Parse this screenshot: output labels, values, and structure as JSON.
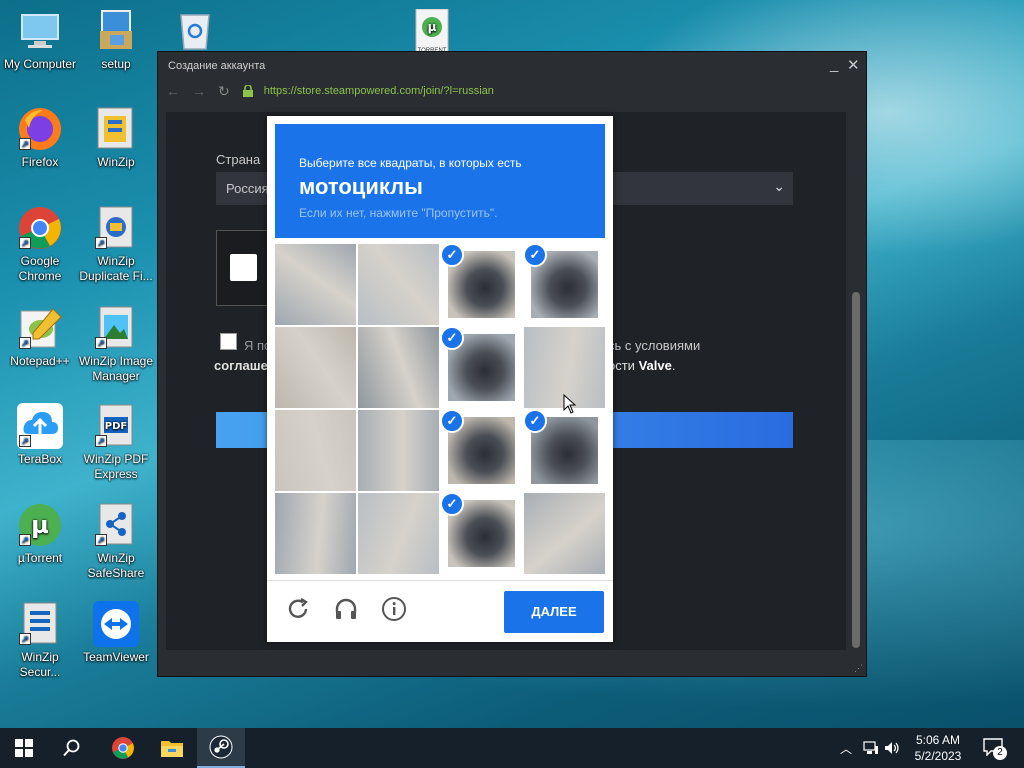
{
  "desktop": {
    "icons": [
      {
        "label": "My Computer"
      },
      {
        "label": "setup"
      },
      {
        "label": "Firefox"
      },
      {
        "label": "WinZip"
      },
      {
        "label": "Google Chrome"
      },
      {
        "label": "WinZip Duplicate Fi..."
      },
      {
        "label": "Notepad++"
      },
      {
        "label": "WinZip Image Manager"
      },
      {
        "label": "TeraBox"
      },
      {
        "label": "WinZip PDF Express"
      },
      {
        "label": "µTorrent"
      },
      {
        "label": "WinZip SafeShare"
      },
      {
        "label": "WinZip Secur..."
      },
      {
        "label": "TeamViewer"
      },
      {
        "label": "TORRENT"
      }
    ]
  },
  "window": {
    "title": "Создание аккаунта",
    "url": "https://store.steampowered.com/join/?l=russian"
  },
  "form": {
    "country_label": "Страна",
    "country_value": "Россия",
    "agree_prefix": "Я по",
    "agree_suffix": "сь с условиями",
    "agree_line2_left": "соглаше",
    "agree_line2_right_a": "ости ",
    "agree_line2_right_b": "Valve",
    "agree_line2_right_c": "."
  },
  "captcha": {
    "instruction": "Выберите все квадраты, в которых есть",
    "target": "мотоциклы",
    "hint": "Если их нет, нажмите \"Пропустить\".",
    "next_button": "ДАЛЕЕ",
    "selected": [
      [
        false,
        false,
        true,
        true
      ],
      [
        false,
        false,
        true,
        false
      ],
      [
        false,
        false,
        true,
        true
      ],
      [
        false,
        false,
        true,
        false
      ]
    ],
    "colors": {
      "accent": "#1a73e8"
    }
  },
  "taskbar": {
    "time": "5:06 AM",
    "date": "5/2/2023",
    "notifications": "2"
  }
}
